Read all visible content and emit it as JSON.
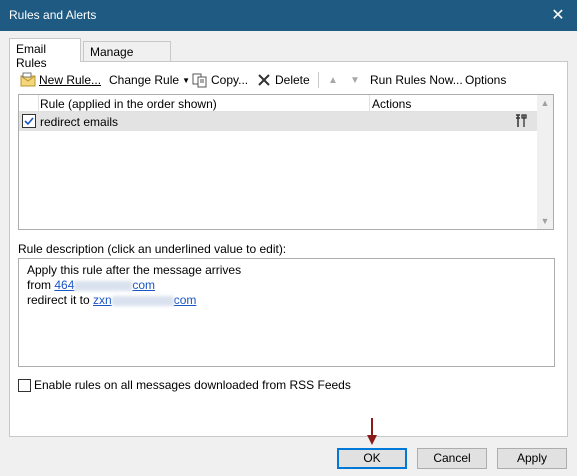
{
  "window": {
    "title": "Rules and Alerts",
    "close_glyph": "✕"
  },
  "tabs": [
    {
      "label": "Email Rules",
      "active": true
    },
    {
      "label": "Manage Alerts",
      "active": false
    }
  ],
  "toolbar": {
    "new_rule": "New Rule...",
    "change_rule": "Change Rule",
    "copy": "Copy...",
    "delete": "Delete",
    "run_rules_now": "Run Rules Now...",
    "options": "Options"
  },
  "rules_list": {
    "columns": [
      "Rule (applied in the order shown)",
      "Actions"
    ],
    "rows": [
      {
        "checked": true,
        "name": "redirect emails",
        "action_icon": "rule-actions-icon"
      }
    ]
  },
  "description": {
    "label": "Rule description (click an underlined value to edit):",
    "line1": "Apply this rule after the message arrives",
    "line2_prefix": "from ",
    "line2_link_start": "464",
    "line2_link_end": "com",
    "line3_prefix": "redirect it to ",
    "line3_link_start": "zxn",
    "line3_link_end": "com"
  },
  "rss_checkbox": {
    "label": "Enable rules on all messages downloaded from RSS Feeds",
    "checked": false
  },
  "buttons": {
    "ok": "OK",
    "cancel": "Cancel",
    "apply": "Apply"
  },
  "colors": {
    "titlebar": "#1f5a82",
    "link": "#1a55c4",
    "arrow": "#8b1a1a",
    "ok_border": "#0078d7"
  }
}
